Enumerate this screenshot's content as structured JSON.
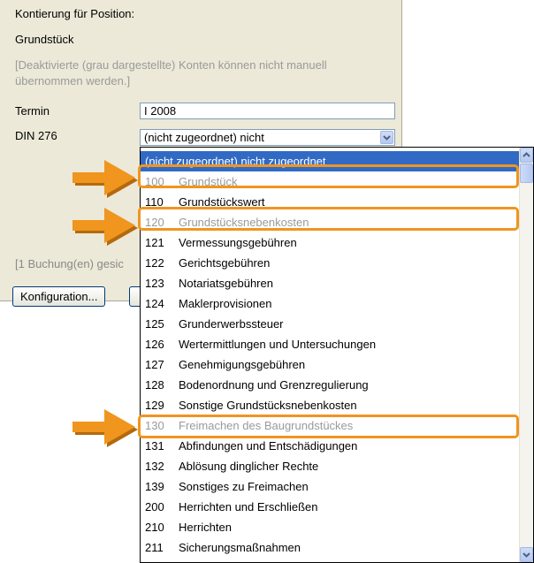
{
  "panel": {
    "title": "Kontierung für Position:",
    "position_name": "Grundstück",
    "hint": "[Deaktivierte (grau dargestellte) Konten können nicht manuell übernommen werden.]",
    "termin_label": "Termin",
    "termin_value": "I 2008",
    "din_label": "DIN 276",
    "din_value": "(nicht zugeordnet)  nicht",
    "booking_status": "[1 Buchung(en) gesic",
    "config_button": "Konfiguration..."
  },
  "dropdown": {
    "items": [
      {
        "code": "(nicht zugeordnet)",
        "label": "nicht zugeordnet",
        "state": "selected"
      },
      {
        "code": "100",
        "label": "Grundstück",
        "state": "disabled"
      },
      {
        "code": "110",
        "label": "Grundstückswert",
        "state": "normal"
      },
      {
        "code": "120",
        "label": "Grundstücksnebenkosten",
        "state": "disabled"
      },
      {
        "code": "121",
        "label": "Vermessungsgebühren",
        "state": "normal"
      },
      {
        "code": "122",
        "label": "Gerichtsgebühren",
        "state": "normal"
      },
      {
        "code": "123",
        "label": "Notariatsgebühren",
        "state": "normal"
      },
      {
        "code": "124",
        "label": "Maklerprovisionen",
        "state": "normal"
      },
      {
        "code": "125",
        "label": "Grunderwerbssteuer",
        "state": "normal"
      },
      {
        "code": "126",
        "label": "Wertermittlungen und Untersuchungen",
        "state": "normal"
      },
      {
        "code": "127",
        "label": "Genehmigungsgebühren",
        "state": "normal"
      },
      {
        "code": "128",
        "label": "Bodenordnung und Grenzregulierung",
        "state": "normal"
      },
      {
        "code": "129",
        "label": "Sonstige Grundstücksnebenkosten",
        "state": "normal"
      },
      {
        "code": "130",
        "label": "Freimachen des Baugrundstückes",
        "state": "disabled"
      },
      {
        "code": "131",
        "label": "Abfindungen und Entschädigungen",
        "state": "normal"
      },
      {
        "code": "132",
        "label": "Ablösung dinglicher Rechte",
        "state": "normal"
      },
      {
        "code": "139",
        "label": "Sonstiges zu Freimachen",
        "state": "normal"
      },
      {
        "code": "200",
        "label": "Herrichten und Erschließen",
        "state": "normal"
      },
      {
        "code": "210",
        "label": "Herrichten",
        "state": "normal"
      },
      {
        "code": "211",
        "label": "Sicherungsmaßnahmen",
        "state": "normal"
      }
    ]
  },
  "colors": {
    "highlight": "#f0951e",
    "disabled_text": "#9a9a9a",
    "selection": "#316ac5",
    "panel_bg": "#ece9d8"
  },
  "icons": {
    "dropdown_button": "chevron-down-icon",
    "scroll_up": "arrow-up-icon",
    "scroll_down": "arrow-down-icon",
    "annotation": "arrow-right-icon"
  }
}
